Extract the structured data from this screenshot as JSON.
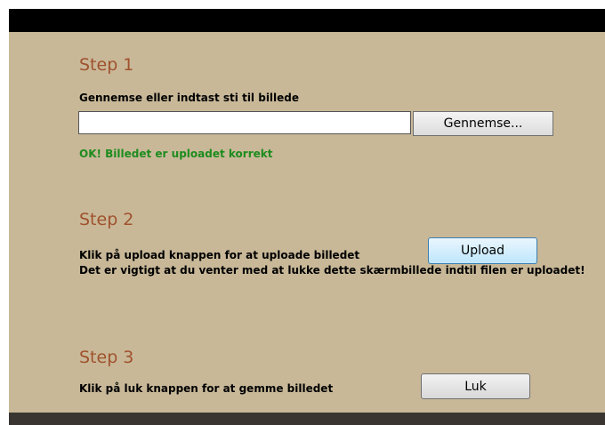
{
  "step1": {
    "title": "Step 1",
    "instruction": "Gennemse eller indtast sti til billede",
    "path_value": "",
    "browse_label": "Gennemse...",
    "status": "OK! Billedet er uploadet korrekt"
  },
  "step2": {
    "title": "Step 2",
    "instruction": "Klik på upload knappen for at uploade billedet",
    "upload_label": "Upload",
    "warning": "Det er vigtigt at du venter med at lukke dette skærmbillede indtil filen er uploadet!"
  },
  "step3": {
    "title": "Step 3",
    "instruction": "Klik på luk knappen for at gemme billedet",
    "close_label": "Luk"
  },
  "colors": {
    "panel_background": "#c8b898",
    "step_title": "#a0522d",
    "success_text": "#1e8c1e",
    "top_bar": "#000000",
    "bottom_bar": "#3a3530"
  }
}
